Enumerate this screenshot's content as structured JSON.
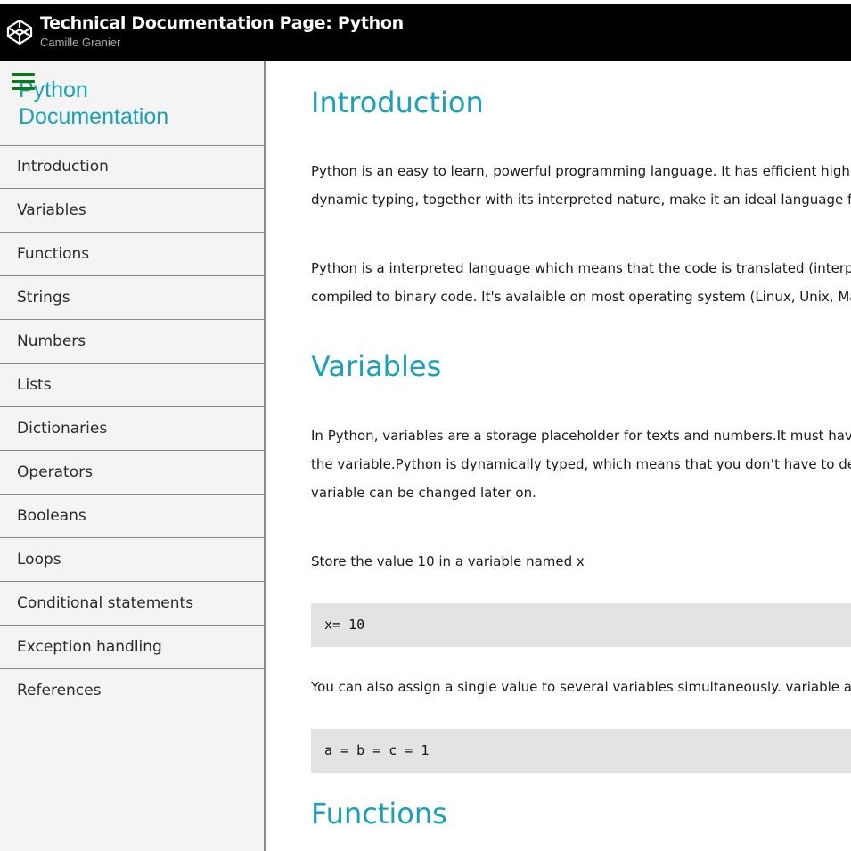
{
  "header": {
    "title": "Technical Documentation Page: Python",
    "author": "Camille Granier",
    "logo_icon": "codepen-cube-icon"
  },
  "sidebar": {
    "menu_icon": "hamburger-menu-icon",
    "title_line1": "Python",
    "title_line2": "Documentation",
    "items": [
      {
        "label": "Introduction"
      },
      {
        "label": "Variables"
      },
      {
        "label": "Functions"
      },
      {
        "label": "Strings"
      },
      {
        "label": "Numbers"
      },
      {
        "label": "Lists"
      },
      {
        "label": "Dictionaries"
      },
      {
        "label": "Operators"
      },
      {
        "label": "Booleans"
      },
      {
        "label": "Loops"
      },
      {
        "label": "Conditional statements"
      },
      {
        "label": "Exception handling"
      },
      {
        "label": "References"
      }
    ]
  },
  "main": {
    "intro": {
      "heading": "Introduction",
      "p1_line1": "Python is an easy to learn, powerful programming language. It has efficient high-level d",
      "p1_line2": "dynamic typing, together with its interpreted nature, make it an ideal language for scrip",
      "p2_line1": "Python is a interpreted language which means that the code is translated (interpreted)",
      "p2_line2": "compiled to binary code. It's avalaible on most operating system (Linux, Unix, Mac OS"
    },
    "variables": {
      "heading": "Variables",
      "p1_line1": "In Python, variables are a storage placeholder for texts and numbers.It must have a na",
      "p1_line2": "the variable.Python is dynamically typed, which means that you don’t have to declare w",
      "p1_line3": "variable can be changed later on.",
      "p2": "Store the value 10 in a variable named x",
      "code1": "x= 10",
      "p3": "You can also assign a single value to several variables simultaneously. variable a,b and",
      "code2": "a = b = c = 1"
    },
    "functions": {
      "heading": "Functions"
    }
  },
  "colors": {
    "accent": "#1aa0b8",
    "header_bg": "#000000",
    "sidebar_bg": "#f4f4f4",
    "code_bg": "#e3e3e3",
    "menu_icon": "#0a7a15"
  }
}
